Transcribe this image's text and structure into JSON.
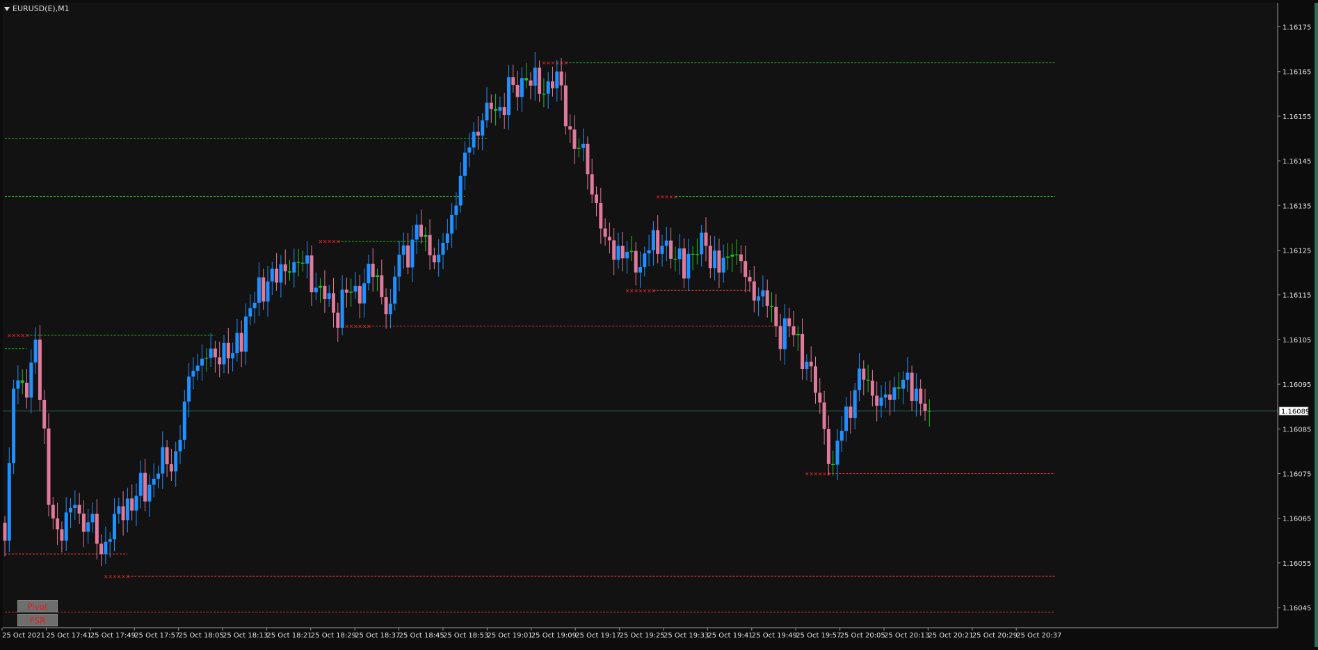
{
  "window": {
    "symbol_label": "EURUSD(E),M1"
  },
  "buttons": {
    "pivot": "Pivot",
    "fsr": "FSR"
  },
  "colors": {
    "background": "#121212",
    "bull": "#1e90ff",
    "bear": "#e07a9a",
    "doji": "#22c022",
    "resistance": "#22c022",
    "support": "#e03a3a",
    "marker": "#ff2a2a",
    "price_line": "#2f6d5a",
    "axis_text": "#e6e6e6"
  },
  "chart_data": {
    "type": "candlestick",
    "title": "EURUSD(E),M1",
    "current_price": "1.16089",
    "ylim": [
      1.16042,
      1.1618
    ],
    "y_ticks": [
      "1.16175",
      "1.16165",
      "1.16155",
      "1.16145",
      "1.16135",
      "1.16125",
      "1.16115",
      "1.16105",
      "1.16095",
      "1.16085",
      "1.16075",
      "1.16065",
      "1.16055",
      "1.16045"
    ],
    "x_ticks": [
      "25 Oct 2021",
      "25 Oct 17:41",
      "25 Oct 17:49",
      "25 Oct 17:57",
      "25 Oct 18:05",
      "25 Oct 18:13",
      "25 Oct 18:21",
      "25 Oct 18:29",
      "25 Oct 18:37",
      "25 Oct 18:45",
      "25 Oct 18:53",
      "25 Oct 19:01",
      "25 Oct 19:09",
      "25 Oct 19:17",
      "25 Oct 19:25",
      "25 Oct 19:33",
      "25 Oct 19:41",
      "25 Oct 19:49",
      "25 Oct 19:57",
      "25 Oct 20:05",
      "25 Oct 20:13",
      "25 Oct 20:21",
      "25 Oct 20:29",
      "25 Oct 20:37"
    ],
    "anchors": [
      [
        0,
        1.1606
      ],
      [
        2,
        1.16094
      ],
      [
        5,
        1.16092
      ],
      [
        7,
        1.16105
      ],
      [
        10,
        1.16068
      ],
      [
        13,
        1.1606
      ],
      [
        16,
        1.16068
      ],
      [
        18,
        1.16062
      ],
      [
        20,
        1.16066
      ],
      [
        22,
        1.16057
      ],
      [
        25,
        1.16066
      ],
      [
        30,
        1.1607
      ],
      [
        35,
        1.16075
      ],
      [
        39,
        1.1608
      ],
      [
        43,
        1.16098
      ],
      [
        47,
        1.16103
      ],
      [
        52,
        1.16102
      ],
      [
        56,
        1.16112
      ],
      [
        60,
        1.16118
      ],
      [
        65,
        1.1612
      ],
      [
        68,
        1.16122
      ],
      [
        72,
        1.16117
      ],
      [
        75,
        1.16111
      ],
      [
        80,
        1.16117
      ],
      [
        84,
        1.16119
      ],
      [
        88,
        1.16113
      ],
      [
        90,
        1.16124
      ],
      [
        95,
        1.16128
      ],
      [
        99,
        1.16124
      ],
      [
        103,
        1.16135
      ],
      [
        106,
        1.16148
      ],
      [
        110,
        1.16158
      ],
      [
        113,
        1.16157
      ],
      [
        116,
        1.16162
      ],
      [
        119,
        1.16163
      ],
      [
        122,
        1.1616
      ],
      [
        126,
        1.16165
      ],
      [
        129,
        1.16152
      ],
      [
        133,
        1.16142
      ],
      [
        137,
        1.16128
      ],
      [
        140,
        1.16126
      ],
      [
        144,
        1.1612
      ],
      [
        147,
        1.16125
      ],
      [
        150,
        1.16126
      ],
      [
        153,
        1.16123
      ],
      [
        157,
        1.16124
      ],
      [
        160,
        1.16126
      ],
      [
        163,
        1.1612
      ],
      [
        166,
        1.16124
      ],
      [
        170,
        1.16118
      ],
      [
        173,
        1.16116
      ],
      [
        176,
        1.16108
      ],
      [
        180,
        1.16106
      ],
      [
        184,
        1.16099
      ],
      [
        187,
        1.16085
      ],
      [
        189,
        1.16077
      ],
      [
        192,
        1.1609
      ],
      [
        196,
        1.16096
      ],
      [
        200,
        1.16092
      ],
      [
        204,
        1.16094
      ],
      [
        208,
        1.16094
      ],
      [
        211,
        1.16089
      ]
    ],
    "levels": [
      {
        "kind": "resistance",
        "price": 1.16167,
        "from_bar": 128,
        "markers_from": 123
      },
      {
        "kind": "resistance",
        "price": 1.16137,
        "from_bar": 153,
        "markers_from": 149
      },
      {
        "kind": "resistance",
        "price": 1.16127,
        "from_bar": 76,
        "markers_from": 72,
        "to_bar": 97
      },
      {
        "kind": "resistance",
        "price": 1.16106,
        "from_bar": 5,
        "markers_from": 1,
        "to_bar": 48
      },
      {
        "kind": "resistance",
        "price": 1.16103,
        "from_bar": 0,
        "to_bar": 5
      },
      {
        "kind": "resistance",
        "price": 1.1615,
        "from_bar": 0,
        "to_bar": 110
      },
      {
        "kind": "resistance",
        "price": 1.16137,
        "from_bar": 0,
        "to_bar": 105
      },
      {
        "kind": "support",
        "price": 1.16116,
        "from_bar": 148,
        "markers_from": 142,
        "to_bar": 170
      },
      {
        "kind": "support",
        "price": 1.16108,
        "from_bar": 83,
        "markers_from": 77,
        "to_bar": 177
      },
      {
        "kind": "support",
        "price": 1.16075,
        "from_bar": 188,
        "markers_from": 183
      },
      {
        "kind": "support",
        "price": 1.16057,
        "from_bar": 0,
        "to_bar": 28
      },
      {
        "kind": "support",
        "price": 1.16052,
        "from_bar": 28,
        "markers_from": 23
      },
      {
        "kind": "support",
        "price": 1.16044,
        "from_bar": 0
      }
    ]
  }
}
